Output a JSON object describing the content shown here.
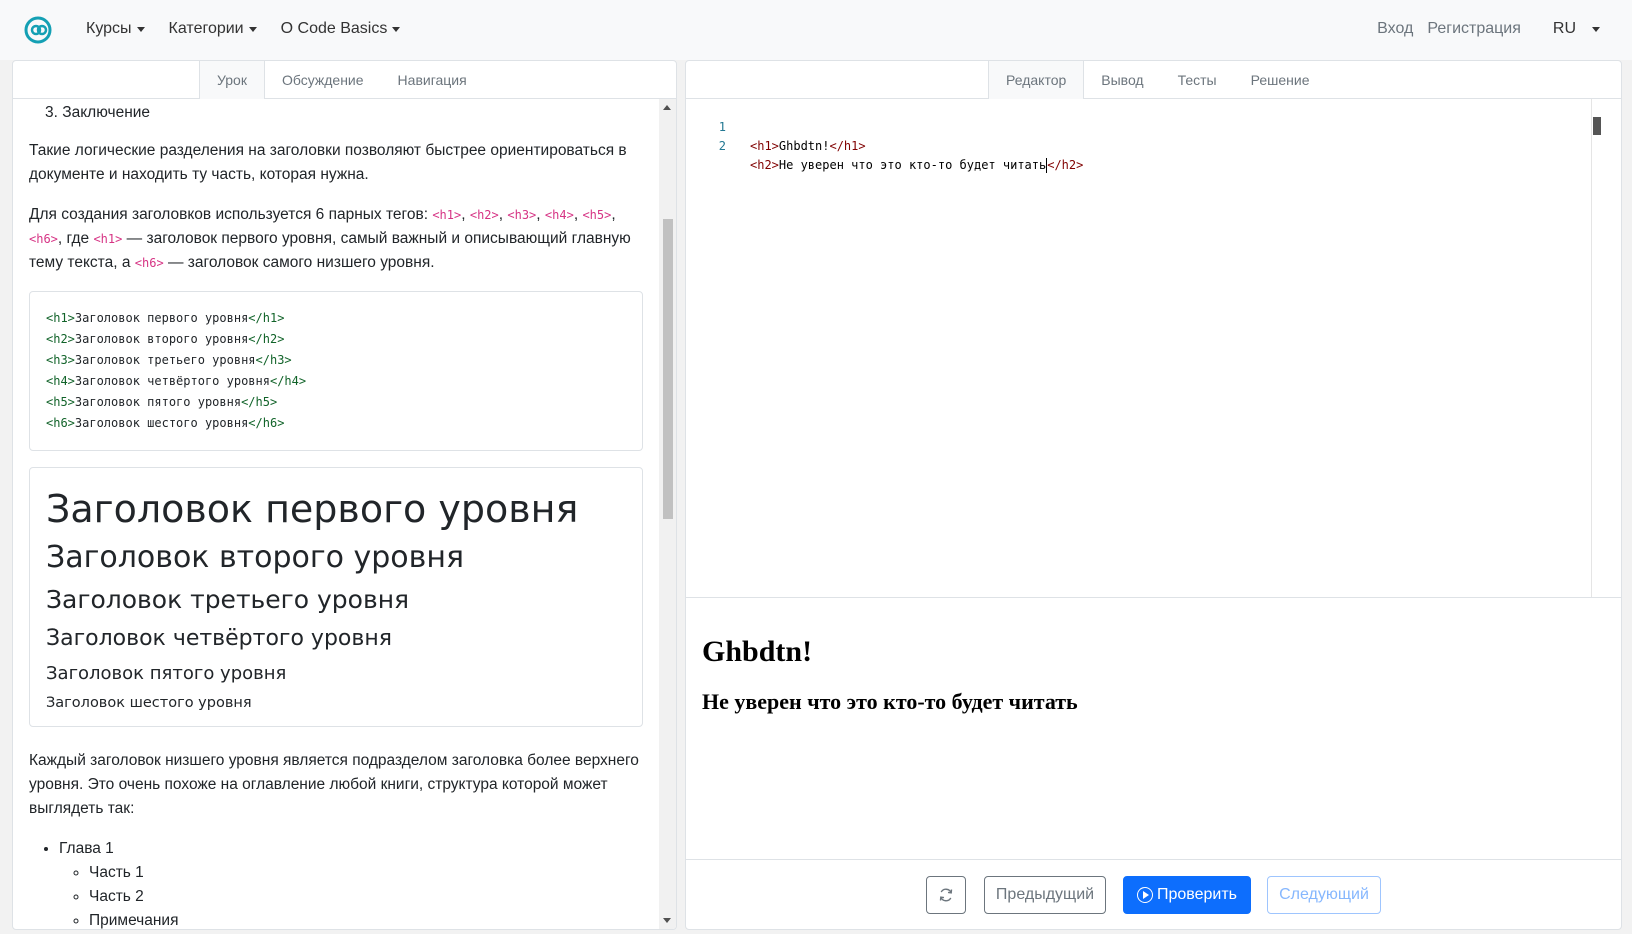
{
  "nav": {
    "items": [
      "Курсы",
      "Категории",
      "О Code Basics"
    ],
    "login": "Вход",
    "register": "Регистрация",
    "lang": "RU"
  },
  "left_tabs": [
    "Урок",
    "Обсуждение",
    "Навигация"
  ],
  "lesson": {
    "ol_item": "3. Заключение",
    "p1": "Такие логические разделения на заголовки позволяют быстрее ориентироваться в документе и находить ту часть, которая нужна.",
    "p2_parts": [
      "Для создания заголовков используется 6 парных тегов: ",
      "<h1>",
      ", ",
      "<h2>",
      ", ",
      "<h3>",
      ", ",
      "<h4>",
      ", ",
      "<h5>",
      ", ",
      "<h6>",
      ", где ",
      "<h1>",
      " — заголовок первого уровня, самый важный и описывающий главную тему текста, а ",
      "<h6>",
      " — заголовок самого низшего уровня."
    ],
    "code_lines": [
      {
        "open": "<h1>",
        "text": "Заголовок первого уровня",
        "close": "</h1>"
      },
      {
        "open": "<h2>",
        "text": "Заголовок второго уровня",
        "close": "</h2>"
      },
      {
        "open": "<h3>",
        "text": "Заголовок третьего уровня",
        "close": "</h3>"
      },
      {
        "open": "<h4>",
        "text": "Заголовок четвёртого уровня",
        "close": "</h4>"
      },
      {
        "open": "<h5>",
        "text": "Заголовок пятого уровня",
        "close": "</h5>"
      },
      {
        "open": "<h6>",
        "text": "Заголовок шестого уровня",
        "close": "</h6>"
      }
    ],
    "demo_headings": [
      "Заголовок первого уровня",
      "Заголовок второго уровня",
      "Заголовок третьего уровня",
      "Заголовок четвёртого уровня",
      "Заголовок пятого уровня",
      "Заголовок шестого уровня"
    ],
    "p3": "Каждый заголовок низшего уровня является подразделом заголовка более верхнего уровня. Это очень похоже на оглавление любой книги, структура которой может выглядеть так:",
    "toc": {
      "chapter": "Глава 1",
      "parts": [
        "Часть 1",
        "Часть 2",
        "Примечания"
      ]
    }
  },
  "right_tabs": [
    "Редактор",
    "Вывод",
    "Тесты",
    "Решение"
  ],
  "editor": {
    "lines": [
      {
        "num": "1",
        "open": "<h1>",
        "text": "Ghbdtn!",
        "close": "</h1>"
      },
      {
        "num": "2",
        "open": "<h2>",
        "text": "Не уверен что это кто-то будет читать",
        "close": "</h2>"
      }
    ]
  },
  "output": {
    "h1": "Ghbdtn!",
    "h2": "Не уверен что это кто-то будет читать"
  },
  "buttons": {
    "prev": "Предыдущий",
    "check": "Проверить",
    "next": "Следующий"
  },
  "colors": {
    "primary": "#0d6efd",
    "code_pink": "#d63384",
    "logo": "#14a0b4"
  }
}
